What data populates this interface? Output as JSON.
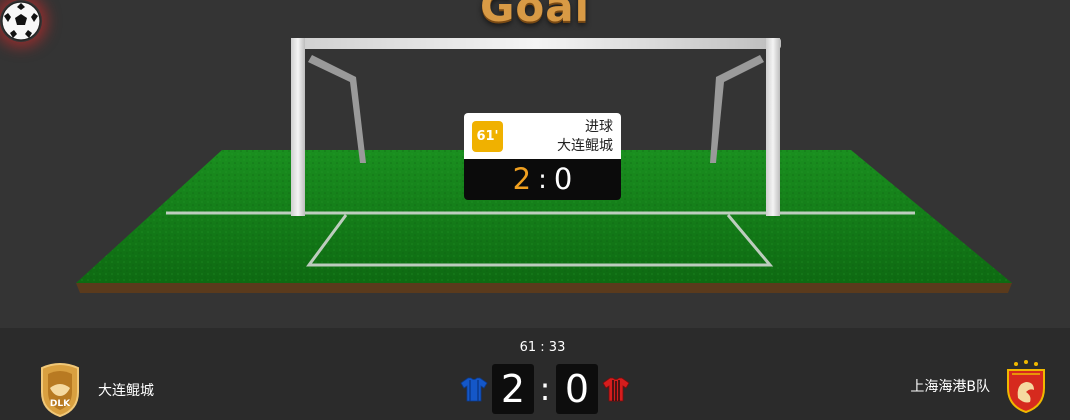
{
  "event": {
    "title": "Goal",
    "minute": "61'",
    "type": "进球",
    "team": "大连鲲城",
    "score_home": "2",
    "score_sep": ":",
    "score_away": "0"
  },
  "match": {
    "clock": "61 : 33",
    "score_home": "2",
    "score_sep": ":",
    "score_away": "0"
  },
  "home_team": {
    "name": "大连鲲城",
    "jersey_color": "#1457c8",
    "logo_color": "#d9a040"
  },
  "away_team": {
    "name": "上海海港B队",
    "jersey_color": "#d61d1d",
    "logo_color": "#d62a1e"
  },
  "icons": {
    "ball": "soccer-ball-icon",
    "home_jersey": "home-jersey-icon",
    "away_jersey": "away-jersey-icon"
  }
}
